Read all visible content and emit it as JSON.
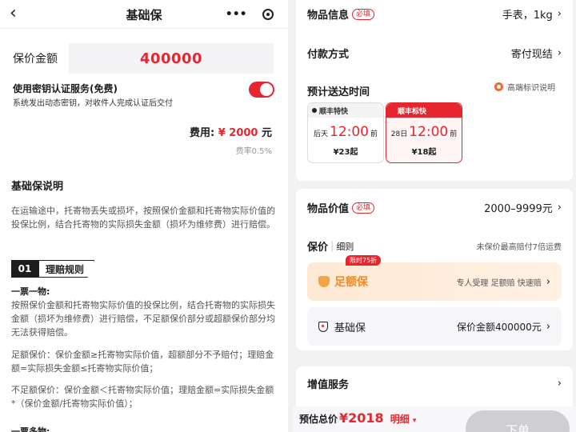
{
  "left": {
    "nav": {
      "back": "‹",
      "title": "基础保",
      "more": "•••"
    },
    "amount_label": "保价金额",
    "amount_value": "400000",
    "key_title": "使用密钥认证服务(免费)",
    "key_desc": "系统发出动态密钥，对收件人完成认证后交付",
    "key_enabled": true,
    "fee_label": "费用: ",
    "fee_value": "¥ 2000",
    "fee_unit": " 元",
    "rate": "费率0.5%",
    "section_title": "基础保说明",
    "intro": "在运输途中，托寄物丢失或损坏，按照保价金额和托寄物实际价值的投保比例，结合托寄物的实际损失金额（损坏为维修费）进行赔偿。",
    "rule_num": "01",
    "rule_title": "理赔规则",
    "one_ticket_one_item": "一票一物:",
    "p2": "按照保价金额和托寄物实际价值的投保比例，结合托寄物的实际损失金额（损坏为维修费）进行赔偿，不足额保价部分或超额保价部分均无法获得赔偿。",
    "p3": "足额保价：保价金额≥托寄物实际价值，超额部分不予赔付；理赔金额=实际损失金额≤托寄物实际价值；",
    "p4": "不足额保价：保价金额＜托寄物实际价值；理赔金额=实际损失金额*（保价金额/托寄物实际价值）；",
    "one_ticket_multi": "一票多物:"
  },
  "right": {
    "item_info_label": "物品信息",
    "required": "必填",
    "item_info_value": "手表，1kg",
    "payment_label": "付款方式",
    "payment_value": "寄付现结",
    "eta_label": "预计送达时间",
    "eta_note": "高端标识说明",
    "services": [
      {
        "name": "顺丰特快",
        "day": "后天",
        "time": "12:00",
        "suffix": "前",
        "price": "¥23起"
      },
      {
        "name": "顺丰标快",
        "day": "28日",
        "time": "12:00",
        "suffix": "前",
        "price": "¥18起"
      }
    ],
    "value_label": "物品价值",
    "value_value": "2000–9999元",
    "insure_label": "保价",
    "insure_sub": "细则",
    "insure_note": "未保价最高赔付7倍运费",
    "full_badge": "限时75折",
    "full_name": "足额保",
    "full_tags": "专人受理 足额赔 快速赔",
    "basic_name": "基础保",
    "basic_amount": "保价金额400000元",
    "vas_label": "增值服务",
    "est_label": "预估总价",
    "est_price": "¥2018",
    "est_detail": "明细",
    "submit": "下单"
  }
}
